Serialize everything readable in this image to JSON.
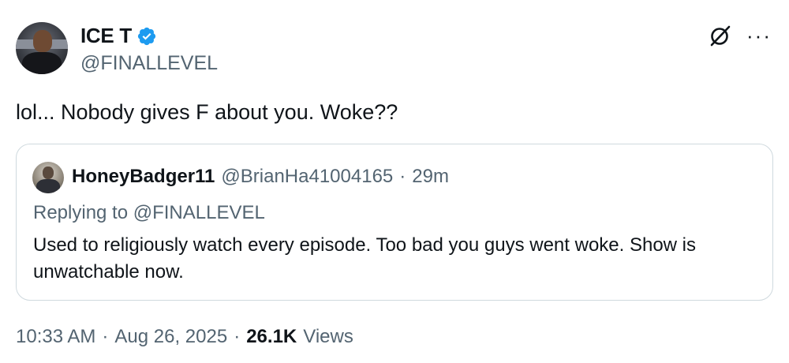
{
  "author": {
    "display_name": "ICE T",
    "handle": "@FINALLEVEL",
    "verified": true,
    "verified_color": "#1d9bf0"
  },
  "tweet": {
    "text": "lol... Nobody gives F about you. Woke??",
    "time": "10:33 AM",
    "date": "Aug 26, 2025",
    "views_count": "26.1K",
    "views_label": "Views",
    "separator": "·"
  },
  "quote": {
    "display_name": "HoneyBadger11",
    "handle": "@BrianHa41004165",
    "separator": "·",
    "time": "29m",
    "replying_to": "Replying to @FINALLEVEL",
    "text": "Used to religiously watch every episode. Too bad you guys went woke. Show is unwatchable now."
  },
  "actions": {
    "grok_icon": "grok-icon",
    "more_icon": "more-icon",
    "more_glyph": "···"
  }
}
